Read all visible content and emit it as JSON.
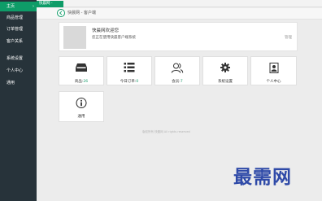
{
  "sidebar": {
    "items": [
      {
        "label": "主页",
        "chevron": "›"
      },
      {
        "label": "商品管理",
        "chevron": ""
      },
      {
        "label": "订单管理",
        "chevron": ""
      },
      {
        "label": "客户关系",
        "chevron": ""
      },
      {
        "label": "系统设置",
        "chevron": ""
      },
      {
        "label": "个人中心",
        "chevron": ""
      },
      {
        "label": "通用",
        "chevron": ""
      }
    ]
  },
  "topbar": {
    "tab_label": "快晨网 -"
  },
  "breadcrumb": {
    "text": "快晨网 - 客户端"
  },
  "welcome": {
    "title": "快晨网欢迎您",
    "desc": "您正在使用快晨客户端系统",
    "right": "管理"
  },
  "tiles": [
    {
      "label": "商品:",
      "num": "26",
      "icon": "box-icon"
    },
    {
      "label": "今日订单:",
      "num": "0",
      "icon": "list-icon"
    },
    {
      "label": "会员:",
      "num": "7",
      "icon": "users-icon"
    },
    {
      "label": "系统设置",
      "num": "",
      "icon": "gear-icon"
    },
    {
      "label": "个人中心",
      "num": "",
      "icon": "contact-card-icon"
    },
    {
      "label": "通用",
      "num": "",
      "icon": "info-icon"
    }
  ],
  "footer": {
    "text": "版权所有 快晨网 All rights reserved"
  },
  "watermark": {
    "text": "最需网"
  },
  "colors": {
    "accent": "#0e9c68",
    "sidebar_bg": "#27333a",
    "number": "#1a9b6b"
  }
}
